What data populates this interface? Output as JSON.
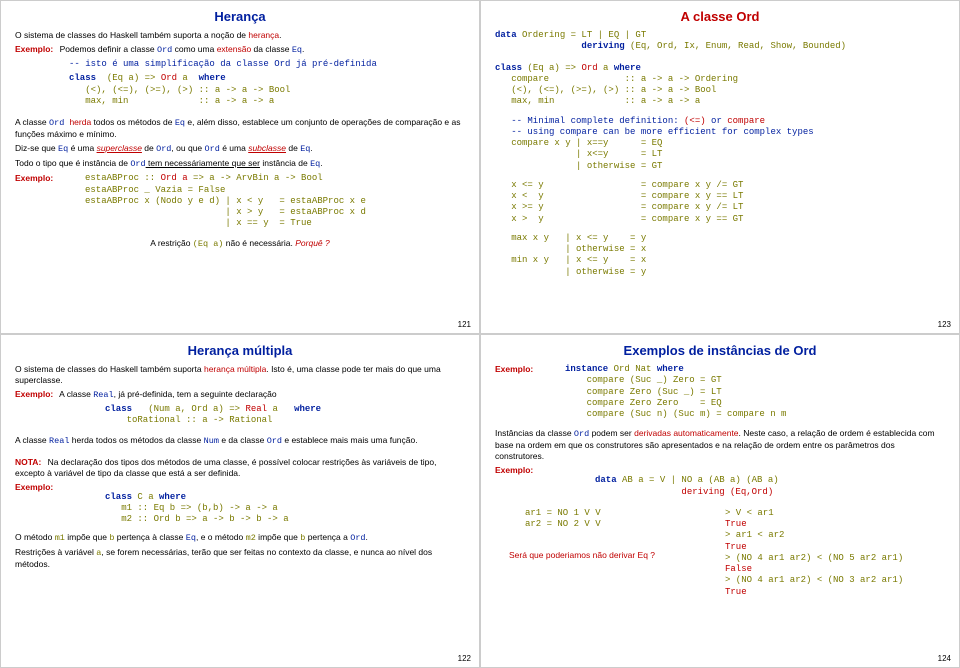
{
  "slides": {
    "s1": {
      "title": "Herança",
      "p1_a": "O sistema de classes do Haskell também suporta a noção de ",
      "p1_b": "herança",
      "p1_c": ".",
      "ex1_lbl": "Exemplo:",
      "ex1_a": "Podemos definir a classe ",
      "ex1_ord": "Ord",
      "ex1_b": " como uma ",
      "ex1_ext": "extensão",
      "ex1_c": " da classe ",
      "ex1_eq": "Eq",
      "ex1_d": ".",
      "comment": "-- isto é uma simplificação da classe Ord já pré-definida",
      "code1": "class  (Eq a) => Ord a  where\n   (<), (<=), (>=), (>) :: a -> a -> Bool\n   max, min             :: a -> a -> a",
      "p2_a": "A classe ",
      "p2_ord": "Ord ",
      "p2_herda": "herda",
      "p2_b": " todos os métodos de ",
      "p2_eq": "Eq",
      "p2_c": " e, além disso, establece um conjunto de operações de comparação e as funções máximo e mínimo.",
      "p3_a": "Diz-se que ",
      "p3_eq": "Eq",
      "p3_b": " é uma ",
      "p3_super": "superclasse",
      "p3_c": " de ",
      "p3_ord": "Ord",
      "p3_d": ", ou que ",
      "p3_ord2": "Ord",
      "p3_e": " é uma ",
      "p3_sub": "subclasse",
      "p3_f": " de ",
      "p3_eq2": "Eq",
      "p3_g": ".",
      "p4_a": "Todo o tipo que é instância de ",
      "p4_ord": "Ord",
      "p4_b": " tem necessáriamente que ser",
      "p4_c": " instância de ",
      "p4_eq": "Eq",
      "p4_d": ".",
      "ex2_lbl": "Exemplo:",
      "code2": "estaABProc :: Ord a => a -> ArvBin a -> Bool\nestaABProc _ Vazia = False\nestaABProc x (Nodo y e d) | x < y   = estaABProc x e\n                          | x > y   = estaABProc x d\n                          | x == y  = True",
      "footer_a": "A restrição ",
      "footer_eq": "(Eq a)",
      "footer_b": " não é necessária. ",
      "footer_q": "Porquê ?",
      "num": "121"
    },
    "s2": {
      "title": "Herança múltipla",
      "p1_a": "O sistema de classes do Haskell também suporta ",
      "p1_b": "herança múltipla",
      "p1_c": ". Isto é, uma classe pode ter mais do que uma superclasse.",
      "ex1_lbl": "Exemplo:",
      "ex1_a": "A classe ",
      "ex1_real": "Real",
      "ex1_b": ", já pré-definida, tem a seguinte declaração",
      "code1": "class   (Num a, Ord a) => Real a   where\n    toRational :: a -> Rational",
      "p2_a": "A classe ",
      "p2_real": "Real",
      "p2_b": " herda todos os métodos da classe ",
      "p2_num": "Num",
      "p2_c": " e da classe ",
      "p2_ord": "Ord",
      "p2_d": " e establece mais mais uma função.",
      "nota_lbl": "NOTA:",
      "nota_txt": "Na declaração dos tipos dos métodos de uma classe, é possível colocar restrições às variáveis de tipo, excepto à variável de tipo da classe que está a ser definida.",
      "ex2_lbl": "Exemplo:",
      "code2": "class C a where\n   m1 :: Eq b => (b,b) -> a -> a\n   m2 :: Ord b => a -> b -> b -> a",
      "p3_a": "O método ",
      "p3_m1": "m1",
      "p3_b": " impõe que ",
      "p3_bb": "b",
      "p3_c": " pertença à classe ",
      "p3_eq": "Eq",
      "p3_d": ", e o método ",
      "p3_m2": "m2",
      "p3_e": " impõe que ",
      "p3_bb2": "b",
      "p3_f": " pertença a ",
      "p3_ord": "Ord",
      "p3_g": ".",
      "p4_a": "Restrições à variável ",
      "p4_av": "a",
      "p4_b": ", se forem necessárias, terão que ser feitas no contexto da classe, e nunca ao nível dos métodos.",
      "num": "122"
    },
    "s3": {
      "title": "A classe Ord",
      "code1": "data Ordering = LT | EQ | GT\n                deriving (Eq, Ord, Ix, Enum, Read, Show, Bounded)",
      "code2": "class (Eq a) => Ord a where\n   compare              :: a -> a -> Ordering\n   (<), (<=), (>=), (>) :: a -> a -> Bool\n   max, min             :: a -> a -> a",
      "cmt1": "-- Minimal complete definition: (<=) or compare",
      "cmt2": "-- using compare can be more efficient for complex types",
      "code3": "   compare x y | x==y      = EQ\n               | x<=y      = LT\n               | otherwise = GT",
      "code4": "   x <= y                  = compare x y /= GT\n   x <  y                  = compare x y == LT\n   x >= y                  = compare x y /= LT\n   x >  y                  = compare x y == GT",
      "code5": "   max x y   | x <= y    = y\n             | otherwise = x\n   min x y   | x <= y    = x\n             | otherwise = y",
      "num": "123"
    },
    "s4": {
      "title": "Exemplos de instâncias de Ord",
      "ex1_lbl": "Exemplo:",
      "code1": "instance Ord Nat where\n    compare (Suc _) Zero = GT\n    compare Zero (Suc _) = LT\n    compare Zero Zero    = EQ\n    compare (Suc n) (Suc m) = compare n m",
      "p1_a": "Instâncias da classe ",
      "p1_ord": "Ord",
      "p1_b": " podem ser ",
      "p1_der": "derivadas automaticamente",
      "p1_c": ". Neste caso, a relação de ordem é establecida com base na ordem em que os construtores são apresentados e na relação de ordem entre os parâmetros dos construtores.",
      "ex2_lbl": "Exemplo:",
      "code2": "data AB a = V | NO a (AB a) (AB a)\n                deriving (Eq,Ord)",
      "code3a": "ar1 = NO 1 V V\nar2 = NO 2 V V",
      "q": "Será que poderiamos não derivar Eq ?",
      "code3b": "> V < ar1\nTrue\n> ar1 < ar2\nTrue\n> (NO 4 ar1 ar2) < (NO 5 ar2 ar1)\nFalse\n> (NO 4 ar1 ar2) < (NO 3 ar2 ar1)\nTrue",
      "num": "124"
    }
  }
}
